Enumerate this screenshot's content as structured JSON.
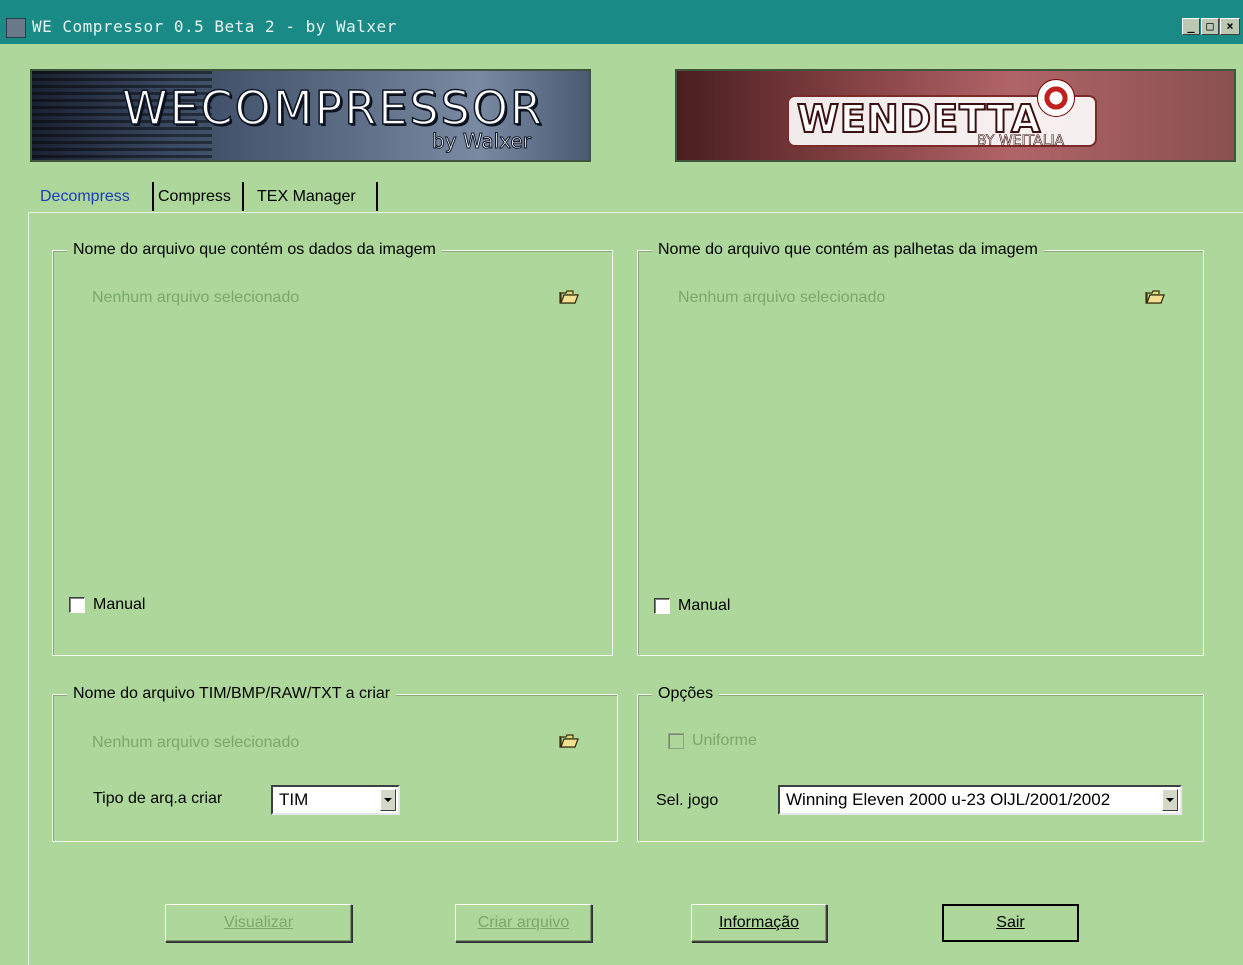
{
  "window": {
    "title": "WE Compressor 0.5 Beta 2 - by Walxer",
    "minimize_label": "_",
    "maximize_label": "□",
    "close_label": "×"
  },
  "banners": {
    "left_logo_text": "WECOMPRESSOR",
    "left_logo_sub": "by Walxer",
    "right_logo_text": "WENDETTA",
    "right_logo_sub": "BY WEITALIA"
  },
  "tabs": [
    "Decompress",
    "Compress",
    "TEX Manager"
  ],
  "panels": {
    "image_data": {
      "title": "Nome do arquivo que contém os dados da imagem",
      "placeholder": "Nenhum arquivo selecionado",
      "manual_label": "Manual"
    },
    "palette": {
      "title": "Nome do arquivo que contém as palhetas da imagem",
      "placeholder": "Nenhum arquivo selecionado",
      "manual_label": "Manual"
    },
    "output_file": {
      "title": "Nome do arquivo TIM/BMP/RAW/TXT a criar",
      "placeholder": "Nenhum arquivo selecionado",
      "type_label": "Tipo de arq.a criar",
      "type_value": "TIM"
    },
    "options": {
      "title": "Opções",
      "uniforme_label": "Uniforme",
      "game_label": "Sel. jogo",
      "game_value": "Winning Eleven 2000 u-23 OlJL/2001/2002"
    }
  },
  "buttons": {
    "visualizar": "Visualizar",
    "criar_arquivo": "Criar arquivo",
    "informacao": "Informação",
    "sair": "Sair"
  },
  "colors": {
    "background": "#aed89b",
    "titlebar": "#1a8a86",
    "active_tab": "#1a3cb8",
    "disabled_text": "#7aa86a"
  }
}
